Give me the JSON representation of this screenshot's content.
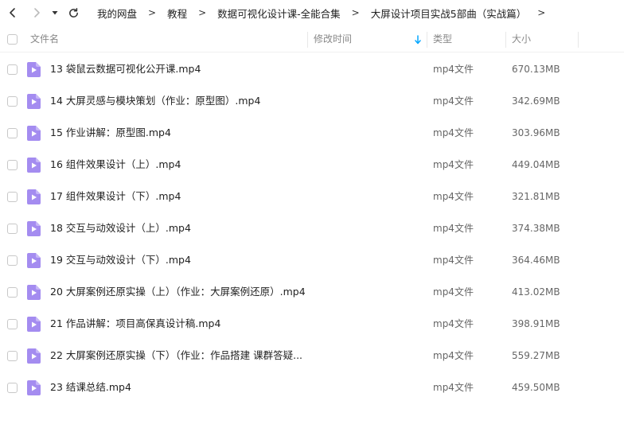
{
  "colors": {
    "accent": "#06a7ff",
    "file_icon": "#a48cf0",
    "text": "#222222",
    "muted": "#888888"
  },
  "breadcrumb": {
    "items": [
      "我的网盘",
      "教程",
      "数据可视化设计课-全能合集",
      "大屏设计项目实战5部曲（实战篇）"
    ],
    "separator": ">"
  },
  "columns": {
    "name": "文件名",
    "modified": "修改时间",
    "type": "类型",
    "size": "大小"
  },
  "files": [
    {
      "name": "13 袋鼠云数据可视化公开课.mp4",
      "type": "mp4文件",
      "size": "670.13MB",
      "icon": "video-file-icon"
    },
    {
      "name": "14 大屏灵感与模块策划（作业：原型图）.mp4",
      "type": "mp4文件",
      "size": "342.69MB",
      "icon": "video-file-icon"
    },
    {
      "name": "15 作业讲解：原型图.mp4",
      "type": "mp4文件",
      "size": "303.96MB",
      "icon": "video-file-icon"
    },
    {
      "name": "16 组件效果设计（上）.mp4",
      "type": "mp4文件",
      "size": "449.04MB",
      "icon": "video-file-icon"
    },
    {
      "name": "17 组件效果设计（下）.mp4",
      "type": "mp4文件",
      "size": "321.81MB",
      "icon": "video-file-icon"
    },
    {
      "name": "18 交互与动效设计（上）.mp4",
      "type": "mp4文件",
      "size": "374.38MB",
      "icon": "video-file-icon"
    },
    {
      "name": "19 交互与动效设计（下）.mp4",
      "type": "mp4文件",
      "size": "364.46MB",
      "icon": "video-file-icon"
    },
    {
      "name": "20 大屏案例还原实操（上）（作业：大屏案例还原）.mp4",
      "type": "mp4文件",
      "size": "413.02MB",
      "icon": "video-file-icon"
    },
    {
      "name": "21 作品讲解：项目高保真设计稿.mp4",
      "type": "mp4文件",
      "size": "398.91MB",
      "icon": "video-file-icon"
    },
    {
      "name": "22 大屏案例还原实操（下）（作业：作品搭建 课群答疑...",
      "type": "mp4文件",
      "size": "559.27MB",
      "icon": "video-file-icon"
    },
    {
      "name": "23 结课总结.mp4",
      "type": "mp4文件",
      "size": "459.50MB",
      "icon": "video-file-icon"
    }
  ]
}
